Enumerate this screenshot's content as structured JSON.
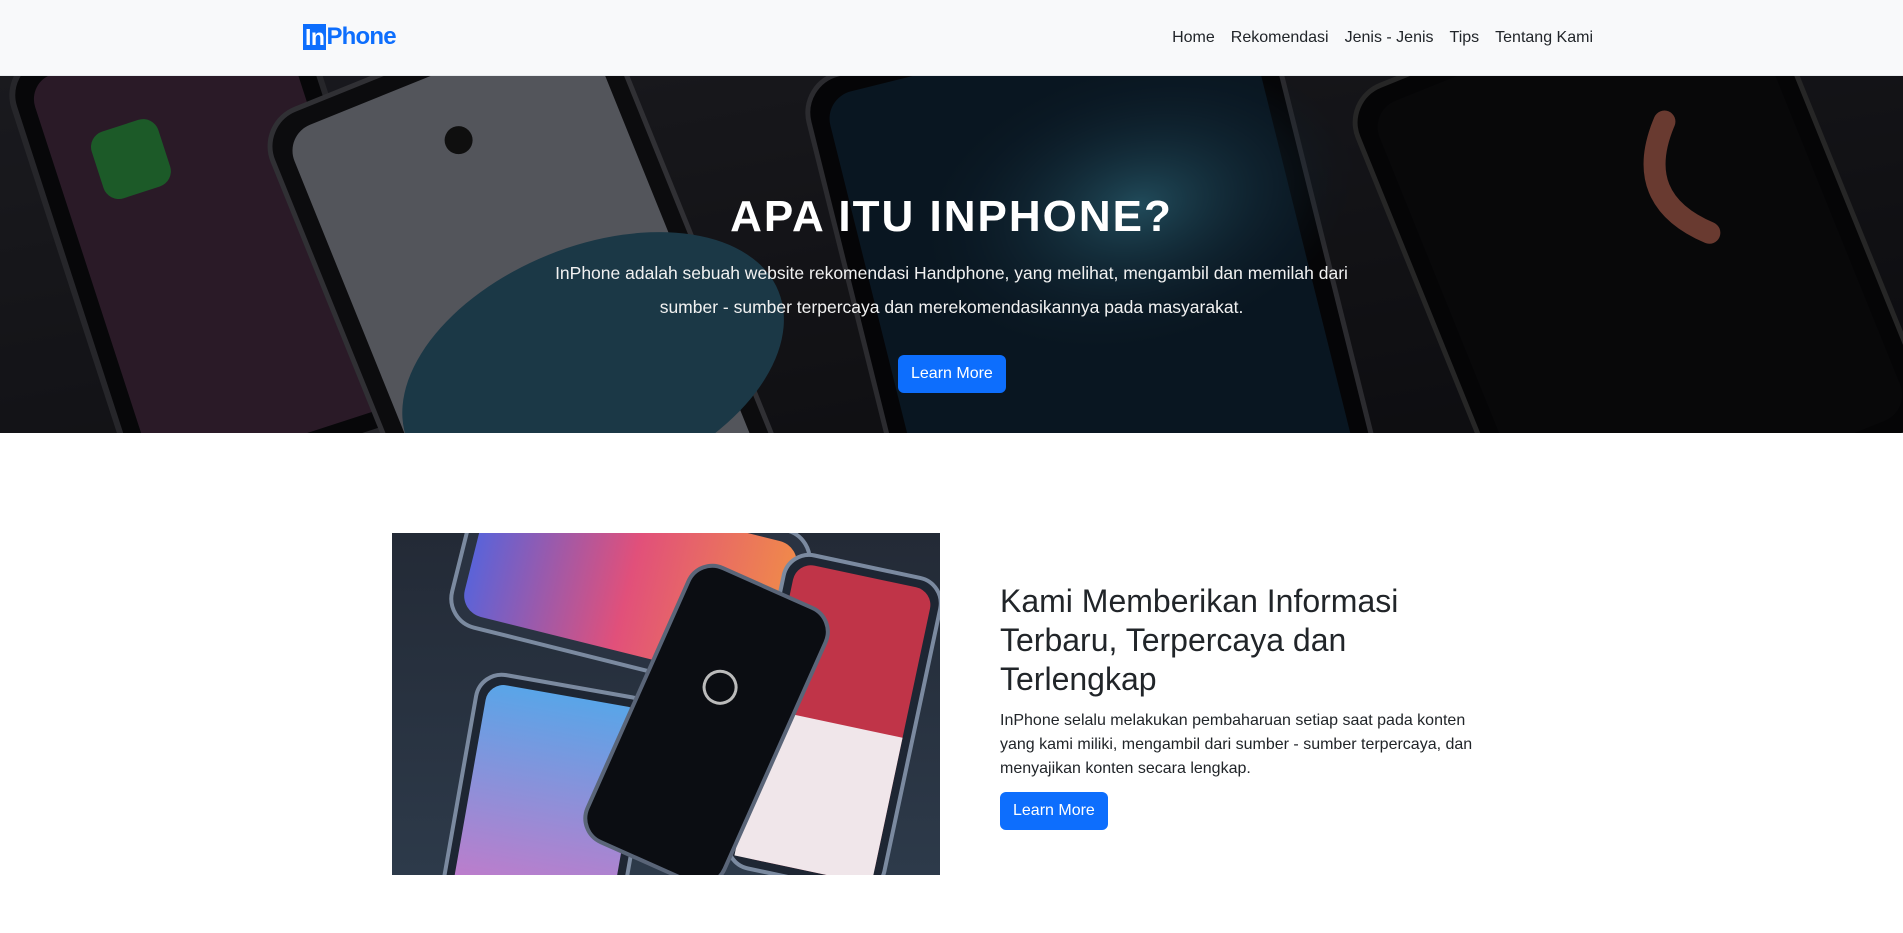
{
  "navbar": {
    "brand_in": "In",
    "brand_rest": "Phone",
    "links": [
      "Home",
      "Rekomendasi",
      "Jenis - Jenis",
      "Tips",
      "Tentang Kami"
    ]
  },
  "hero": {
    "title": "APA ITU INPHONE?",
    "text": "InPhone adalah sebuah website rekomendasi Handphone, yang melihat, mengambil dan memilah dari sumber - sumber terpercaya dan merekomendasikannya pada masyarakat.",
    "button_label": "Learn More"
  },
  "feature": {
    "title": "Kami Memberikan Informasi Terbaru, Terpercaya dan Terlengkap",
    "description": "InPhone selalu melakukan pembaharuan setiap saat pada konten yang kami miliki, mengambil dari sumber - sumber terpercaya, dan menyajikan konten secara lengkap.",
    "button_label": "Learn More"
  },
  "colors": {
    "primary": "#0d6efd",
    "navbar_bg": "#f8f9fa",
    "text": "#212529"
  }
}
